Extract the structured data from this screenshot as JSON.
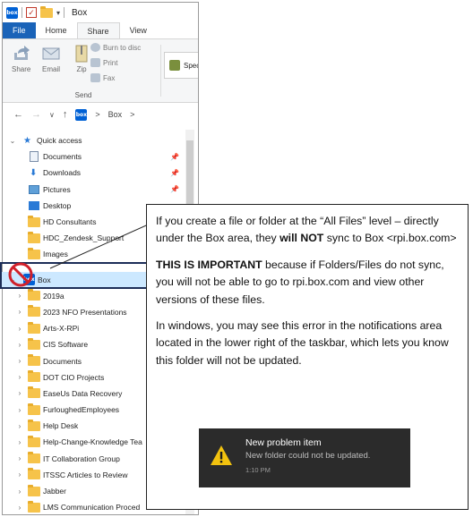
{
  "window": {
    "title": "Box",
    "tabs": [
      "File",
      "Home",
      "Share",
      "View"
    ],
    "active_tab": "Share"
  },
  "ribbon": {
    "share_label": "Share",
    "email_label": "Email",
    "zip_label": "Zip",
    "burn_label": "Burn to disc",
    "print_label": "Print",
    "fax_label": "Fax",
    "group_label": "Send",
    "specific_label": "Speci"
  },
  "address": {
    "separator": ">",
    "location": "Box"
  },
  "tree": {
    "quick_access": "Quick access",
    "quick_items": [
      "Documents",
      "Downloads",
      "Pictures",
      "Desktop",
      "HD Consultants",
      "HDC_Zendesk_Support",
      "Images"
    ],
    "box_label": "Box",
    "box_children": [
      "2019a",
      "2023 NFO Presentations",
      "Arts-X-RPi",
      "CIS Software",
      "Documents",
      "DOT CIO Projects",
      "EaseUs Data Recovery",
      "FurloughedEmployees",
      "Help Desk",
      "Help-Change-Knowledge Tea",
      "IT Collaboration Group",
      "ITSSC Articles to Review",
      "Jabber",
      "LMS Communication Proced"
    ]
  },
  "callout": {
    "p1_before": "If you create a file or folder at the “All Files” level – directly under the Box area, they ",
    "p1_bold": "will NOT",
    "p1_after": " sync to Box <rpi.box.com>",
    "p2_bold": "THIS IS IMPORTANT",
    "p2_after": " because if Folders/Files do not sync, you will not be able to go to rpi.box.com and view other versions of these files.",
    "p3": "In windows, you may see this error in the notifications area located in the lower right of the taskbar, which lets you know this folder will not be updated."
  },
  "toast": {
    "title": "New problem item",
    "message": "New folder could not be updated.",
    "time": "1:10 PM"
  },
  "colors": {
    "file_tab": "#1a63b8",
    "box_brand": "#0061d5",
    "highlight_border": "#1c2d57",
    "no_sign": "#d0202a",
    "folder": "#f6c34a",
    "toast_bg": "#2b2b2b",
    "warning": "#f2c20f"
  }
}
